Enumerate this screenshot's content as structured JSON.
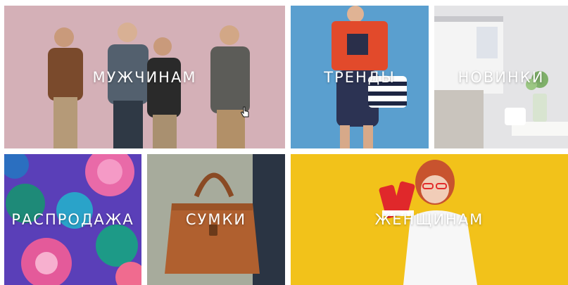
{
  "tiles": {
    "men": {
      "label": "МУЖЧИНАМ"
    },
    "trends": {
      "label": "ТРЕНДЫ"
    },
    "new": {
      "label": "НОВИНКИ"
    },
    "sale": {
      "label": "РАСПРОДАЖА"
    },
    "bags": {
      "label": "СУМКИ"
    },
    "women": {
      "label": "ЖЕНЩИНАМ"
    }
  },
  "colors": {
    "men_bg": "#d4b0b7",
    "trends_bg": "#5a9fcf",
    "new_bg": "#e4e4e6",
    "sale_bg": "#5a3fb8",
    "bags_bg": "#a7ab9c",
    "women_bg": "#f2c21a"
  },
  "icons": {
    "cursor": "hand-pointer-icon"
  }
}
